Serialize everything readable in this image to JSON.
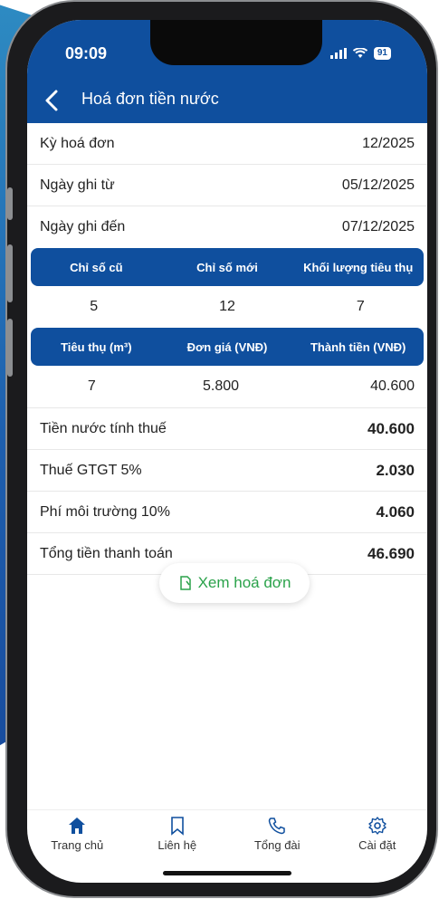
{
  "status": {
    "time": "09:09",
    "battery": "91"
  },
  "header": {
    "title": "Hoá đơn tiền nước"
  },
  "info": [
    {
      "label": "Kỳ hoá đơn",
      "value": "12/2025"
    },
    {
      "label": "Ngày ghi từ",
      "value": "05/12/2025"
    },
    {
      "label": "Ngày ghi đến",
      "value": "07/12/2025"
    }
  ],
  "meter_table": {
    "headers": [
      "Chỉ số cũ",
      "Chỉ số mới",
      "Khối lượng tiêu thụ"
    ],
    "values": [
      "5",
      "12",
      "7"
    ]
  },
  "price_table": {
    "headers": [
      "Tiêu thụ (m³)",
      "Đơn giá (VNĐ)",
      "Thành tiền (VNĐ)"
    ],
    "values": [
      "7",
      "5.800",
      "40.600"
    ]
  },
  "summary": [
    {
      "label": "Tiền nước tính thuế",
      "value": "40.600"
    },
    {
      "label": "Thuế GTGT 5%",
      "value": "2.030"
    },
    {
      "label": "Phí môi trường 10%",
      "value": "4.060"
    },
    {
      "label": "Tổng tiền thanh toán",
      "value": "46.690"
    }
  ],
  "view_invoice": {
    "label": "Xem hoá đơn"
  },
  "tabs": [
    {
      "label": "Trang chủ",
      "icon": "home-icon"
    },
    {
      "label": "Liên hệ",
      "icon": "bookmark-icon"
    },
    {
      "label": "Tổng đài",
      "icon": "phone-icon"
    },
    {
      "label": "Cài đặt",
      "icon": "gear-icon"
    }
  ],
  "colors": {
    "primary": "#0f4f9e",
    "accent": "#2aa24a"
  }
}
